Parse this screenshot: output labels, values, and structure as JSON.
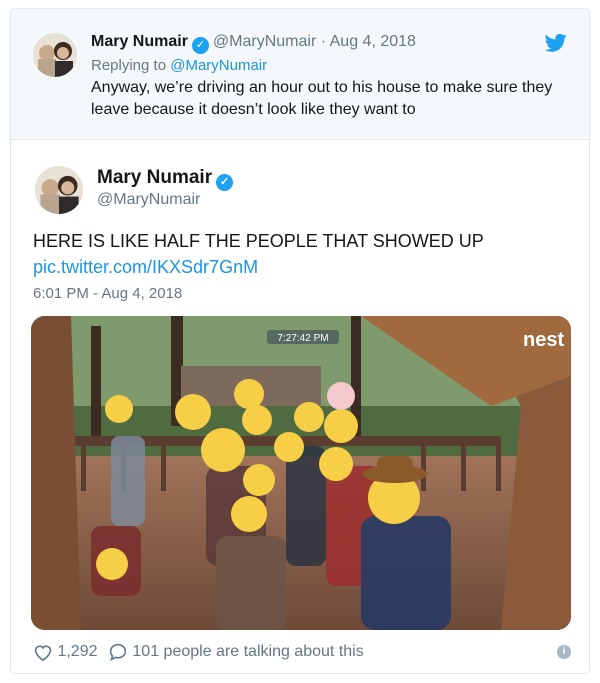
{
  "parent_tweet": {
    "name": "Mary Numair",
    "handle": "@MaryNumair",
    "separator": "·",
    "date": "Aug 4, 2018",
    "replying_prefix": "Replying to",
    "replying_to": "@MaryNumair",
    "text": "Anyway, we’re driving an hour out to his house to make sure they leave because it doesn’t look like they want to"
  },
  "main_tweet": {
    "name": "Mary Numair",
    "handle": "@MaryNumair",
    "text": "HERE IS LIKE HALF THE PEOPLE THAT SHOWED UP",
    "link": "pic.twitter.com/IKXSdr7GnM",
    "timestamp": "6:01 PM - Aug 4, 2018",
    "photo": {
      "camera_time": "7:27:42 PM",
      "brand": "nest"
    }
  },
  "footer": {
    "likes": "1,292",
    "replies_label": "101 people are talking about this"
  },
  "icons": {
    "verified": "verified-badge-icon",
    "twitter": "twitter-bird-icon",
    "heart": "heart-icon",
    "reply": "reply-bubble-icon",
    "info": "info-icon"
  },
  "colors": {
    "twitter_blue": "#1da1f2",
    "link": "#1b95e0",
    "muted": "#657786",
    "parent_bg": "#f5f8fa"
  }
}
